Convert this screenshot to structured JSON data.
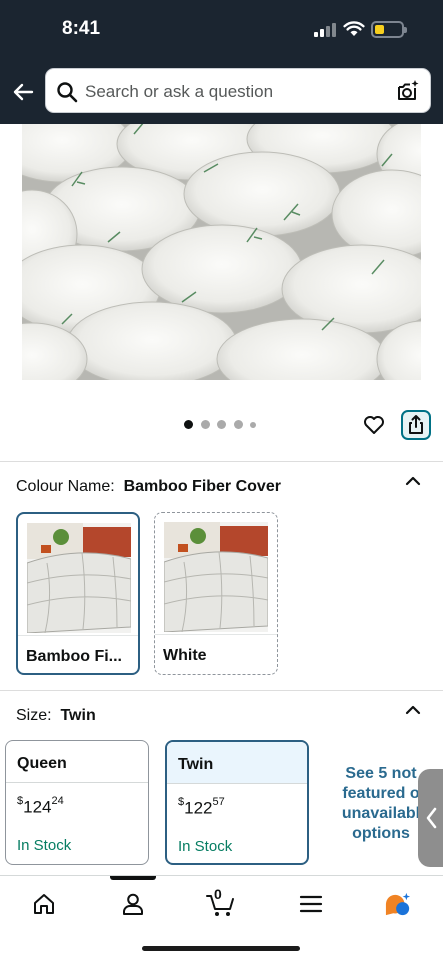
{
  "status_bar": {
    "time": "8:41",
    "battery_level": 0.35,
    "icons": [
      "cellular-signal-icon",
      "wifi-icon",
      "battery-icon"
    ]
  },
  "header": {
    "search_placeholder": "Search or ask a question",
    "icons": [
      "back-arrow-icon",
      "search-icon",
      "camera-lens-icon"
    ]
  },
  "product_image": {
    "description_icon": "mattress-topper-photo",
    "carousel": {
      "page_count": 5,
      "active_index": 0
    }
  },
  "actions": {
    "icons": [
      "heart-icon",
      "share-icon"
    ]
  },
  "colour": {
    "label": "Colour Name:",
    "selected_value": "Bamboo Fiber Cover",
    "options": [
      {
        "label": "Bamboo Fi...",
        "selected": true
      },
      {
        "label": "White",
        "selected": false
      }
    ]
  },
  "size": {
    "label": "Size:",
    "selected_value": "Twin",
    "options": [
      {
        "name": "Queen",
        "currency": "$",
        "price_whole": "124",
        "price_fraction": "24",
        "stock": "In Stock",
        "selected": false
      },
      {
        "name": "Twin",
        "currency": "$",
        "price_whole": "122",
        "price_fraction": "57",
        "stock": "In Stock",
        "selected": true
      }
    ],
    "see_more": "See 5 not featured or unavailable options",
    "see_more_lines": [
      "See 5 not",
      "featured o",
      "unavailabl",
      "options"
    ]
  },
  "bottom_nav": {
    "items": [
      "home-icon",
      "account-icon",
      "cart-icon",
      "menu-icon",
      "rufus-assistant-icon"
    ],
    "cart_count": "0",
    "active": "account-icon"
  },
  "colors": {
    "header_bg": "#1b2530",
    "accent": "#2c5f82",
    "in_stock": "#067d62",
    "link": "#2a6a8f"
  }
}
